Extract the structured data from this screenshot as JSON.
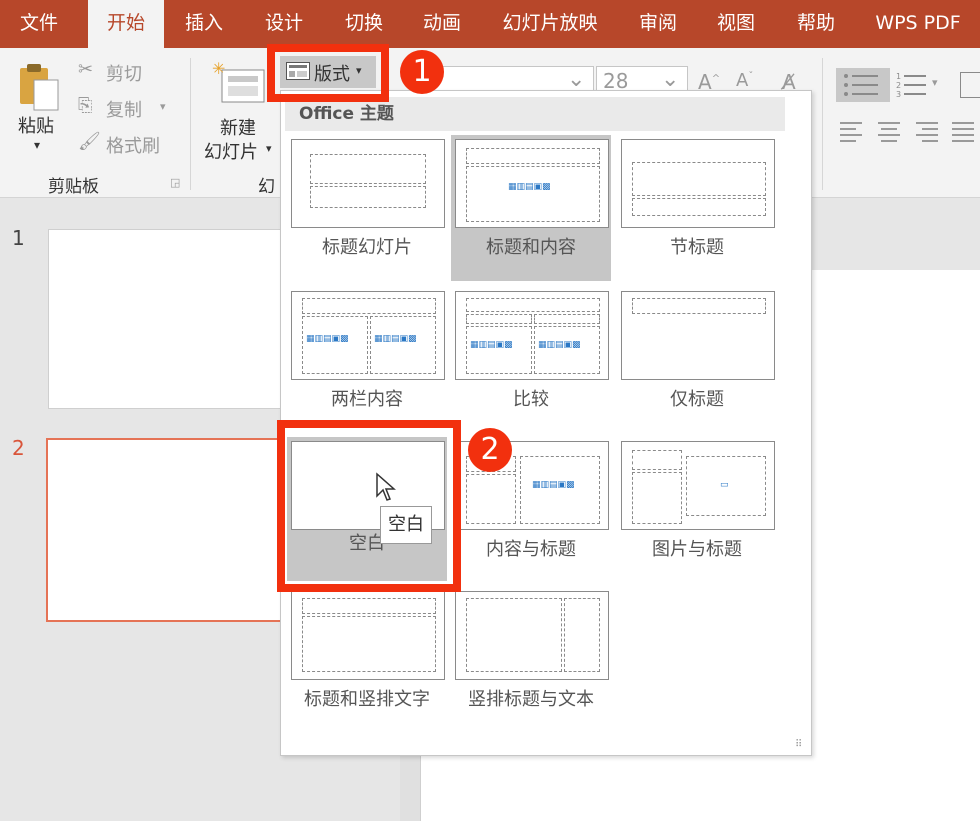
{
  "tabs": [
    {
      "label": "文件",
      "active": false
    },
    {
      "label": "开始",
      "active": true
    },
    {
      "label": "插入",
      "active": false
    },
    {
      "label": "设计",
      "active": false
    },
    {
      "label": "切换",
      "active": false
    },
    {
      "label": "动画",
      "active": false
    },
    {
      "label": "幻灯片放映",
      "active": false
    },
    {
      "label": "审阅",
      "active": false
    },
    {
      "label": "视图",
      "active": false
    },
    {
      "label": "帮助",
      "active": false
    },
    {
      "label": "WPS PDF",
      "active": false
    }
  ],
  "ribbon": {
    "paste_label": "粘贴",
    "cut_label": "剪切",
    "copy_label": "复制",
    "format_painter_label": "格式刷",
    "clipboard_group": "剪贴板",
    "new_slide_line1": "新建",
    "new_slide_line2": "幻灯片",
    "slides_group_partial": "幻",
    "layout_button": "版式",
    "font_size": "28"
  },
  "gallery": {
    "header": "Office 主题",
    "layouts": [
      {
        "label": "标题幻灯片",
        "kind": "title"
      },
      {
        "label": "标题和内容",
        "kind": "title-content"
      },
      {
        "label": "节标题",
        "kind": "section"
      },
      {
        "label": "两栏内容",
        "kind": "two-content"
      },
      {
        "label": "比较",
        "kind": "comparison"
      },
      {
        "label": "仅标题",
        "kind": "title-only"
      },
      {
        "label": "空白",
        "kind": "blank"
      },
      {
        "label": "内容与标题",
        "kind": "content-caption"
      },
      {
        "label": "图片与标题",
        "kind": "picture-caption"
      },
      {
        "label": "标题和竖排文字",
        "kind": "title-vertical"
      },
      {
        "label": "竖排标题与文本",
        "kind": "vertical-title"
      }
    ],
    "tooltip": "空白"
  },
  "slides": [
    {
      "number": "1"
    },
    {
      "number": "2"
    }
  ],
  "annotations": [
    {
      "label": "1"
    },
    {
      "label": "2"
    }
  ],
  "colors": {
    "brand": "#b7472a",
    "highlight": "#f2300e",
    "selected_slide": "#e57356"
  }
}
